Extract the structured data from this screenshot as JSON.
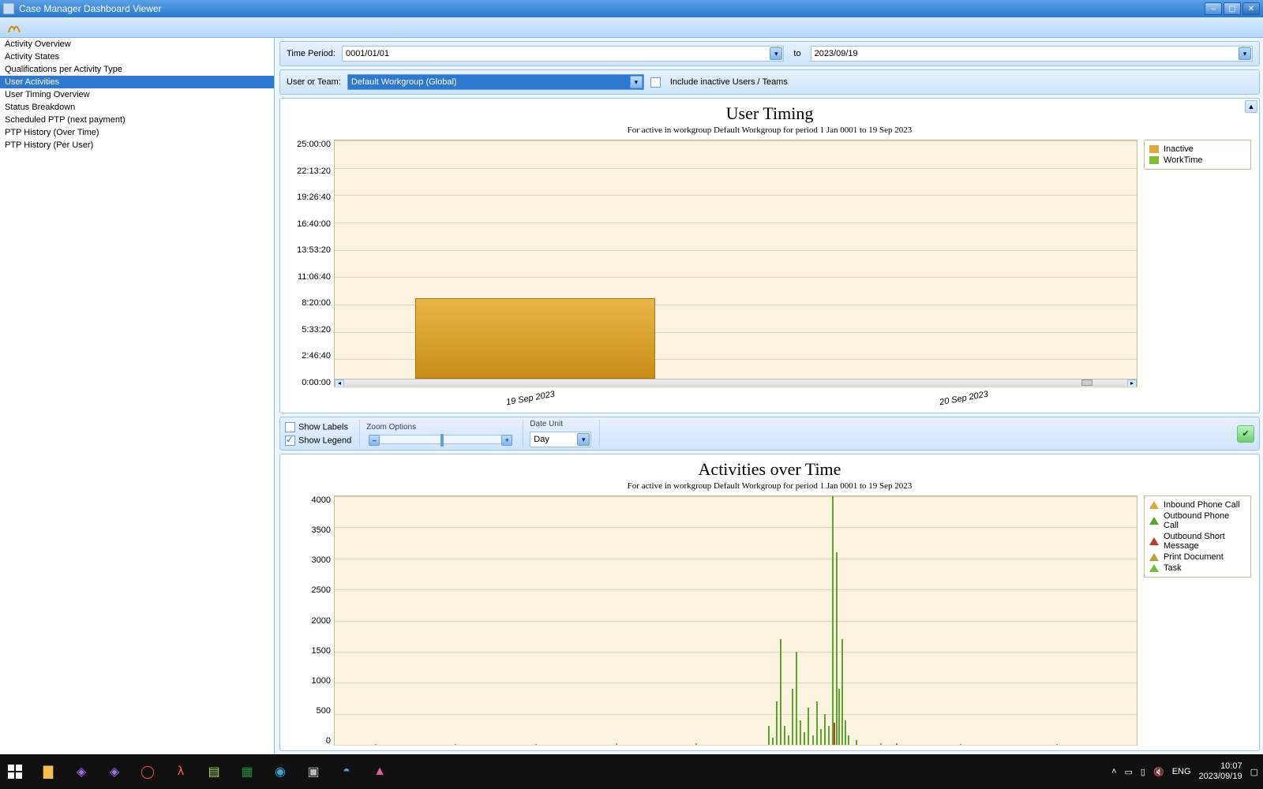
{
  "window": {
    "title": "Case Manager Dashboard Viewer"
  },
  "sidebar": {
    "items": [
      "Activity Overview",
      "Activity States",
      "Qualifications per Activity Type",
      "User Activities",
      "User Timing Overview",
      "Status Breakdown",
      "Scheduled PTP (next payment)",
      "PTP History (Over Time)",
      "PTP History (Per User)"
    ],
    "selected_index": 3
  },
  "filters": {
    "period_label": "Time Period:",
    "from": "0001/01/01",
    "to_label": "to",
    "to": "2023/09/19",
    "team_label": "User or Team:",
    "team_value": "Default Workgroup (Global)",
    "inactive_label": "Include inactive Users / Teams",
    "inactive_checked": false
  },
  "options": {
    "show_labels_label": "Show Labels",
    "show_labels": false,
    "show_legend_label": "Show Legend",
    "show_legend": true,
    "zoom_label": "Zoom Options",
    "date_unit_label": "Date Unit",
    "date_unit_value": "Day"
  },
  "chart1": {
    "title": "User Timing",
    "subtitle": "For active in  workgroup Default Workgroup for period 1 Jan 0001 to 19 Sep 2023",
    "yticks": [
      "25:00:00",
      "22:13:20",
      "19:26:40",
      "16:40:00",
      "13:53:20",
      "11:06:40",
      "8:20:00",
      "5:33:20",
      "2:46:40",
      "0:00:00"
    ],
    "xticks": [
      "19 Sep 2023",
      "20 Sep 2023"
    ],
    "legend": [
      {
        "label": "Inactive",
        "color": "#e0a83a"
      },
      {
        "label": "WorkTime",
        "color": "#7fbf2f"
      }
    ]
  },
  "chart2": {
    "title": "Activities over Time",
    "subtitle": "For active in workgroup Default Workgroup for period 1 Jan 0001 to 19 Sep 2023",
    "yticks": [
      "4000",
      "3500",
      "3000",
      "2500",
      "2000",
      "1500",
      "1000",
      "500",
      "0"
    ],
    "legend": [
      {
        "label": "Inbound Phone Call",
        "color": "#d9a93a"
      },
      {
        "label": "Outbound Phone Call",
        "color": "#5aa62a"
      },
      {
        "label": "Outbound Short Message",
        "color": "#c43a2a"
      },
      {
        "label": "Print Document",
        "color": "#b8a23a"
      },
      {
        "label": "Task",
        "color": "#6fbf3a"
      }
    ]
  },
  "tray": {
    "lang": "ENG",
    "time": "10:07",
    "date": "2023/09/19"
  },
  "chart_data": [
    {
      "type": "bar",
      "title": "User Timing",
      "xlabel": "",
      "ylabel": "Duration (hh:mm:ss)",
      "ylim_seconds": [
        0,
        90000
      ],
      "categories": [
        "19 Sep 2023"
      ],
      "series": [
        {
          "name": "Inactive",
          "values_seconds": [
            32400
          ]
        },
        {
          "name": "WorkTime",
          "values_seconds": [
            0
          ]
        }
      ]
    },
    {
      "type": "line",
      "title": "Activities over Time",
      "xlabel": "",
      "ylabel": "Count",
      "ylim": [
        0,
        4000
      ],
      "note": "x positions are relative (0–1) across visible range; values read from chart gridlines",
      "series": [
        {
          "name": "Outbound Phone Call",
          "color": "#5aa62a",
          "points": [
            {
              "x": 0.54,
              "y": 300
            },
            {
              "x": 0.545,
              "y": 120
            },
            {
              "x": 0.55,
              "y": 700
            },
            {
              "x": 0.555,
              "y": 1700
            },
            {
              "x": 0.56,
              "y": 300
            },
            {
              "x": 0.565,
              "y": 150
            },
            {
              "x": 0.57,
              "y": 900
            },
            {
              "x": 0.575,
              "y": 1500
            },
            {
              "x": 0.58,
              "y": 400
            },
            {
              "x": 0.585,
              "y": 200
            },
            {
              "x": 0.59,
              "y": 600
            },
            {
              "x": 0.595,
              "y": 150
            },
            {
              "x": 0.6,
              "y": 700
            },
            {
              "x": 0.605,
              "y": 250
            },
            {
              "x": 0.61,
              "y": 500
            },
            {
              "x": 0.615,
              "y": 300
            },
            {
              "x": 0.62,
              "y": 4000
            },
            {
              "x": 0.625,
              "y": 3100
            },
            {
              "x": 0.628,
              "y": 900
            },
            {
              "x": 0.632,
              "y": 1700
            },
            {
              "x": 0.636,
              "y": 400
            },
            {
              "x": 0.64,
              "y": 150
            },
            {
              "x": 0.65,
              "y": 80
            },
            {
              "x": 0.7,
              "y": 20
            }
          ]
        },
        {
          "name": "Outbound Short Message",
          "color": "#c43a2a",
          "points": [
            {
              "x": 0.622,
              "y": 350
            }
          ]
        },
        {
          "name": "Task",
          "color": "#6fbf3a",
          "points": [
            {
              "x": 0.05,
              "y": 10
            },
            {
              "x": 0.15,
              "y": 15
            },
            {
              "x": 0.25,
              "y": 10
            },
            {
              "x": 0.35,
              "y": 20
            },
            {
              "x": 0.45,
              "y": 25
            },
            {
              "x": 0.68,
              "y": 30
            },
            {
              "x": 0.78,
              "y": 15
            },
            {
              "x": 0.9,
              "y": 10
            }
          ]
        }
      ]
    }
  ]
}
